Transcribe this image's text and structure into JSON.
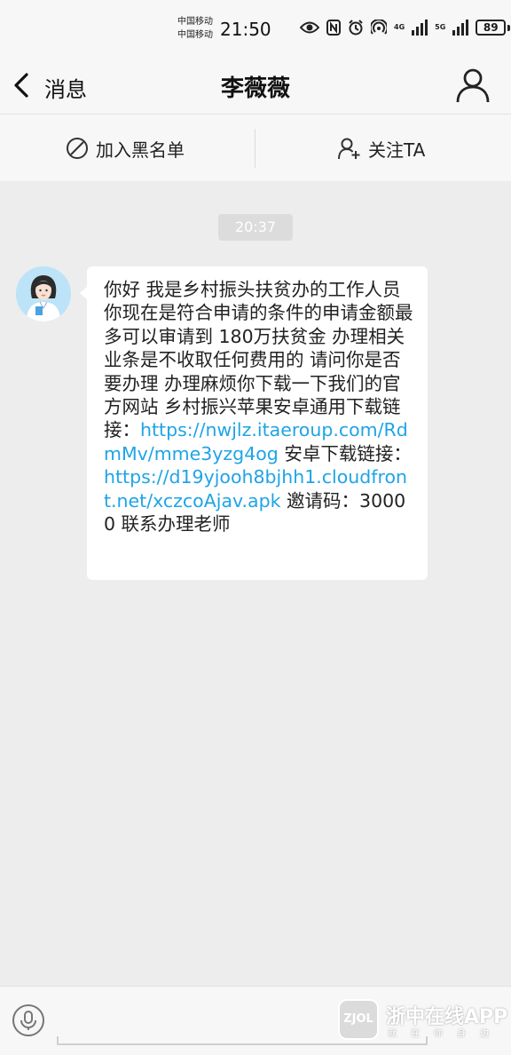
{
  "status_bar": {
    "carrier_1": "中国移动",
    "carrier_2": "中国移动",
    "time": "21:50",
    "network_1": "4G",
    "network_2": "5G",
    "battery": "89"
  },
  "header": {
    "back_label": "消息",
    "title": "李薇薇"
  },
  "actions": {
    "block_label": "加入黑名单",
    "follow_label": "关注TA"
  },
  "conversation": {
    "timestamp": "20:37",
    "message": {
      "text_1": "你好 我是乡村振头扶贫办的工作人员 你现在是符合申请的条件的申请金额最多可以审请到 180万扶贫金 办理相关业条是不收取任何费用的 请问你是否要办理  办理麻烦你下载一下我们的官方网站 乡村振兴苹果安卓通用下载链接：",
      "link_1": "https://nwjlz.itaeroup.com/RdmMv/mme3yzg4og",
      "text_2": "安卓下载链接：",
      "link_2": "https://d19yjooh8bjhh1.cloudfront.net/xczcoAjav.apk",
      "text_3": "邀请码：30000 联系办理老师"
    }
  },
  "watermark": {
    "logo_text": "ZJOL",
    "name": "浙中在线APP",
    "tagline": "就在你身边"
  },
  "colors": {
    "link": "#1fa4e6",
    "bar_background": "#f7f7f7",
    "chat_background": "#ededed",
    "timestamp_pill": "#dcdcdc"
  }
}
